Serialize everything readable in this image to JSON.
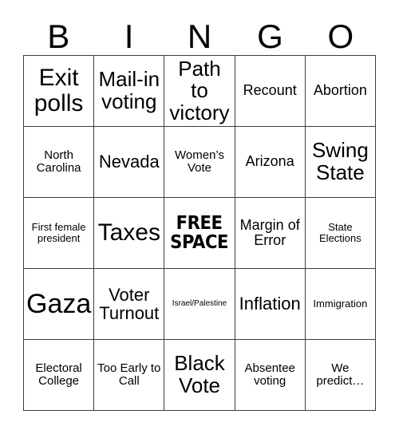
{
  "card": {
    "type": "bingo-card",
    "title_letters": [
      "B",
      "I",
      "N",
      "G",
      "O"
    ],
    "columns": 5,
    "rows": 5,
    "colors": {
      "background": "#ffffff",
      "text": "#000000",
      "grid_line": "#3d3d3d"
    },
    "cells": [
      [
        {
          "text": "Exit polls",
          "size": "s-xl"
        },
        {
          "text": "Mail-in voting",
          "size": "s-lg"
        },
        {
          "text": "Path to victory",
          "size": "s-lg"
        },
        {
          "text": "Recount",
          "size": "s-sm"
        },
        {
          "text": "Abortion",
          "size": "s-sm"
        }
      ],
      [
        {
          "text": "North Carolina",
          "size": "s-xs"
        },
        {
          "text": "Nevada",
          "size": "s-md"
        },
        {
          "text": "Women’s Vote",
          "size": "s-xs"
        },
        {
          "text": "Arizona",
          "size": "s-sm"
        },
        {
          "text": "Swing State",
          "size": "s-lg"
        }
      ],
      [
        {
          "text": "First female president",
          "size": "s-xxs"
        },
        {
          "text": "Taxes",
          "size": "s-xl"
        },
        {
          "text": "FREE SPACE",
          "size": "free-space"
        },
        {
          "text": "Margin of Error",
          "size": "s-sm"
        },
        {
          "text": "State Elections",
          "size": "s-xxs"
        }
      ],
      [
        {
          "text": "Gaza",
          "size": "s-xxl"
        },
        {
          "text": "Voter Turnout",
          "size": "s-md"
        },
        {
          "text": "Israel/Palestine",
          "size": "s-tiny"
        },
        {
          "text": "Inflation",
          "size": "s-md"
        },
        {
          "text": "Immigration",
          "size": "s-xxs"
        }
      ],
      [
        {
          "text": "Electoral College",
          "size": "s-xs"
        },
        {
          "text": "Too Early to Call",
          "size": "s-xs"
        },
        {
          "text": "Black Vote",
          "size": "s-lg"
        },
        {
          "text": "Absentee voting",
          "size": "s-xs"
        },
        {
          "text": "We predict…",
          "size": "s-xs"
        }
      ]
    ]
  }
}
